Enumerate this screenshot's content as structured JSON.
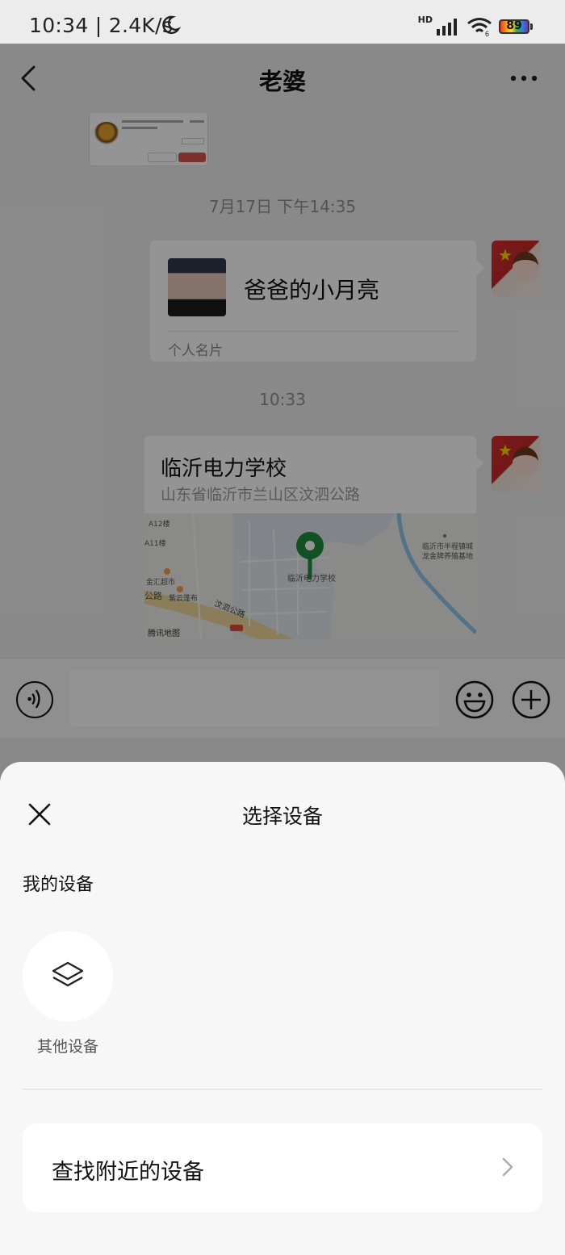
{
  "status_bar": {
    "time_speed": "10:34 | 2.4K/s",
    "network": "HD",
    "battery": "89",
    "wifi_badge": "6"
  },
  "chat": {
    "title": "老婆",
    "messages": [
      {
        "type": "time",
        "text": "7月17日 下午14:35"
      },
      {
        "type": "contact_card",
        "name": "爸爸的小月亮",
        "footer": "个人名片"
      },
      {
        "type": "time",
        "text": "10:33"
      },
      {
        "type": "location",
        "title": "临沂电力学校",
        "address": "山东省临沂市兰山区汶泗公路",
        "map": {
          "school_label": "临沂电力学校",
          "labels": [
            "A12楼",
            "A11楼",
            "金汇超市",
            "紫云蓬布",
            "临沂市半程镇城",
            "龙金牌养殖基地",
            "公路"
          ],
          "road": "汶泗公路",
          "credit": "腾讯地图"
        }
      }
    ]
  },
  "sheet": {
    "title": "选择设备",
    "section_label": "我的设备",
    "device": {
      "label": "其他设备",
      "icon": "layers-icon"
    },
    "find_nearby": "查找附近的设备"
  },
  "colors": {
    "map_pin": "#1e8e3e",
    "overlay": "rgba(0,0,0,0.42)",
    "sheet_bg": "#f7f7f7"
  }
}
